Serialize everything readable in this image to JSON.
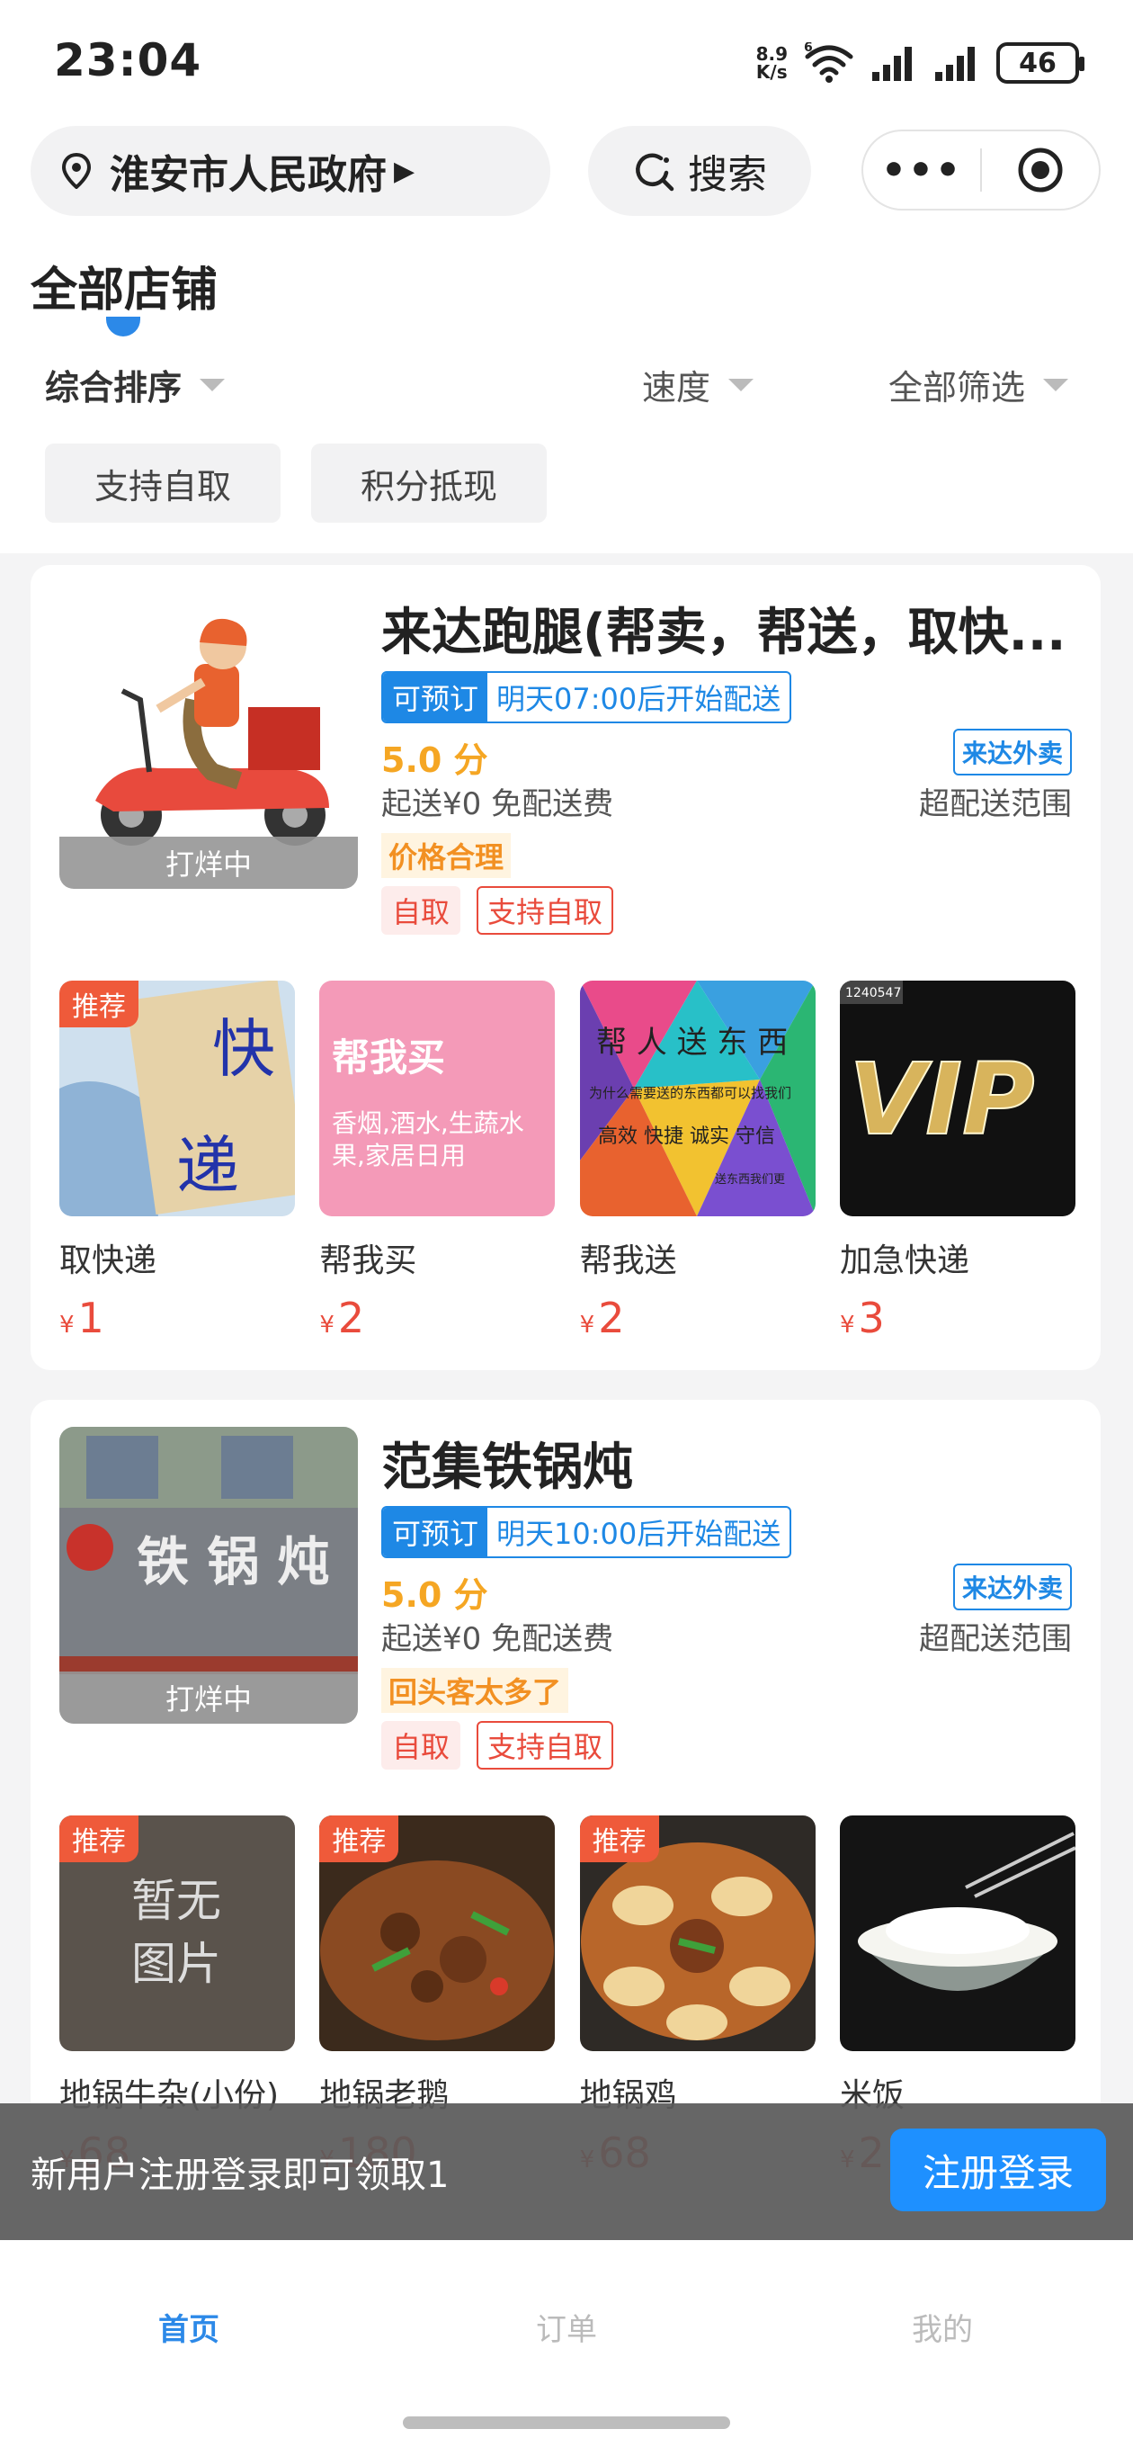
{
  "status_bar": {
    "time": "23:04",
    "net_speed_top": "8.9",
    "net_speed_bottom": "K/s",
    "wifi_tag": "6",
    "battery": "46"
  },
  "nav": {
    "location": "淮安市人民政府",
    "search_label": "搜索",
    "more_label": "•••"
  },
  "section": {
    "title": "全部店铺",
    "sort": [
      "综合排序",
      "速度",
      "全部筛选"
    ],
    "chips": [
      "支持自取",
      "积分抵现"
    ]
  },
  "stores": [
    {
      "name": "来达跑腿(帮卖，帮送，取快...",
      "image_overlay": "打烊中",
      "preorder_tag": "可预订",
      "preorder_text": "明天07:00后开始配送",
      "rating": "5.0 分",
      "brand": "来达外卖",
      "delivery": "起送¥0  免配送费",
      "range": "超配送范围",
      "highlight": "价格合理",
      "tags": [
        "自取",
        "支持自取"
      ],
      "products": [
        {
          "name": "取快递",
          "price": "1",
          "recommend": "推荐",
          "image_text": [
            "快",
            "递"
          ]
        },
        {
          "name": "帮我买",
          "price": "2",
          "recommend": "",
          "image_text": [
            "帮我买",
            "香烟,酒水,生蔬水",
            "果,家居日用"
          ]
        },
        {
          "name": "帮我送",
          "price": "2",
          "recommend": "",
          "image_text": [
            "帮 人 送 东 西",
            "为什么需要送的东西都可以找我们",
            "高效  快捷  诚实  守信",
            "送东西我们更"
          ]
        },
        {
          "name": "加急快递",
          "price": "3",
          "recommend": "",
          "image_text": [
            "1240547",
            "VIP"
          ]
        }
      ]
    },
    {
      "name": "范集铁锅炖",
      "image_overlay": "打烊中",
      "image_sign": "铁 锅 炖",
      "preorder_tag": "可预订",
      "preorder_text": "明天10:00后开始配送",
      "rating": "5.0 分",
      "brand": "来达外卖",
      "delivery": "起送¥0  免配送费",
      "range": "超配送范围",
      "highlight": "回头客太多了",
      "tags": [
        "自取",
        "支持自取"
      ],
      "products": [
        {
          "name": "地锅牛杂(小份)",
          "price": "68",
          "recommend": "推荐",
          "image_text": [
            "暂无",
            "图片"
          ]
        },
        {
          "name": "地锅老鹅",
          "price": "180",
          "recommend": "推荐"
        },
        {
          "name": "地锅鸡",
          "price": "68",
          "recommend": "推荐"
        },
        {
          "name": "米饭",
          "price": "2",
          "recommend": ""
        }
      ]
    }
  ],
  "currency": "¥",
  "banner": {
    "text": "新用户注册登录即可领取1",
    "button": "注册登录"
  },
  "tabs": [
    "首页",
    "订单",
    "我的"
  ],
  "colors": {
    "accent": "#2c89e8",
    "price": "#e94b3c",
    "rating": "#f5a623",
    "recommend": "#ef5a3a"
  }
}
